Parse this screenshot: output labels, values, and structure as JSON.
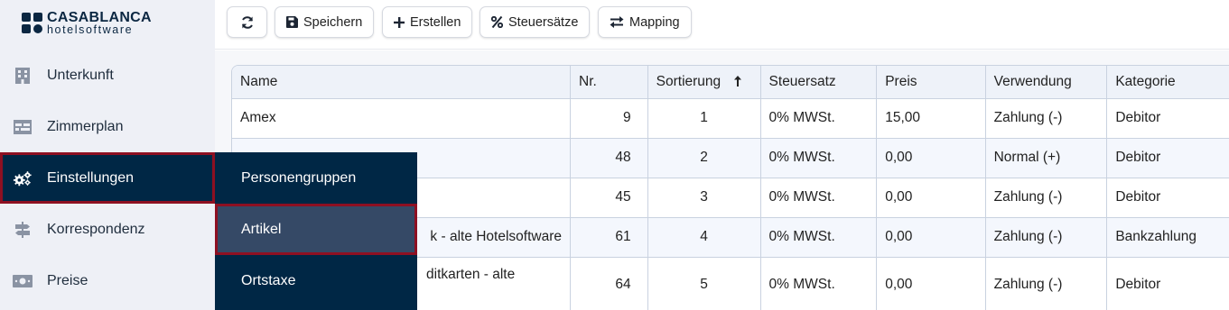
{
  "brand": {
    "line1": "CASABLANCA",
    "line2": "hotelsoftware"
  },
  "sidebar": {
    "items": [
      {
        "label": "Unterkunft",
        "icon": "building-icon"
      },
      {
        "label": "Zimmerplan",
        "icon": "calendar-grid-icon"
      },
      {
        "label": "Einstellungen",
        "icon": "gears-icon",
        "active": true
      },
      {
        "label": "Korrespondenz",
        "icon": "signpost-icon"
      },
      {
        "label": "Preise",
        "icon": "money-bill-icon"
      }
    ]
  },
  "toolbar": {
    "refresh_icon": "refresh-icon",
    "save_label": "Speichern",
    "create_label": "Erstellen",
    "tax_label": "Steuersätze",
    "mapping_label": "Mapping"
  },
  "submenu": {
    "items": [
      {
        "label": "Personengruppen"
      },
      {
        "label": "Artikel",
        "selected": true
      },
      {
        "label": "Ortstaxe"
      }
    ]
  },
  "table": {
    "columns": [
      "Name",
      "Nr.",
      "Sortierung",
      "Steuersatz",
      "Preis",
      "Verwendung",
      "Kategorie"
    ],
    "sort_column": "Sortierung",
    "sort_direction": "ascending",
    "rows": [
      {
        "name": "Amex",
        "nr": "9",
        "sort": "1",
        "tax": "0% MWSt.",
        "price": "15,00",
        "usage": "Zahlung (-)",
        "category": "Debitor"
      },
      {
        "name": "",
        "nr": "48",
        "sort": "2",
        "tax": "0% MWSt.",
        "price": "0,00",
        "usage": "Normal (+)",
        "category": "Debitor"
      },
      {
        "name": "",
        "nr": "45",
        "sort": "3",
        "tax": "0% MWSt.",
        "price": "0,00",
        "usage": "Zahlung (-)",
        "category": "Debitor"
      },
      {
        "name": "k - alte Hotelsoftware",
        "nr": "61",
        "sort": "4",
        "tax": "0% MWSt.",
        "price": "0,00",
        "usage": "Zahlung (-)",
        "category": "Bankzahlung"
      },
      {
        "name": "ditkarten - alte",
        "nr": "64",
        "sort": "5",
        "tax": "0% MWSt.",
        "price": "0,00",
        "usage": "Zahlung (-)",
        "category": "Debitor"
      }
    ]
  },
  "colors": {
    "navy": "#002745",
    "highlight_border": "#8e1022",
    "submenu_selected": "#354966",
    "sidebar_bg": "#eef0f6"
  }
}
